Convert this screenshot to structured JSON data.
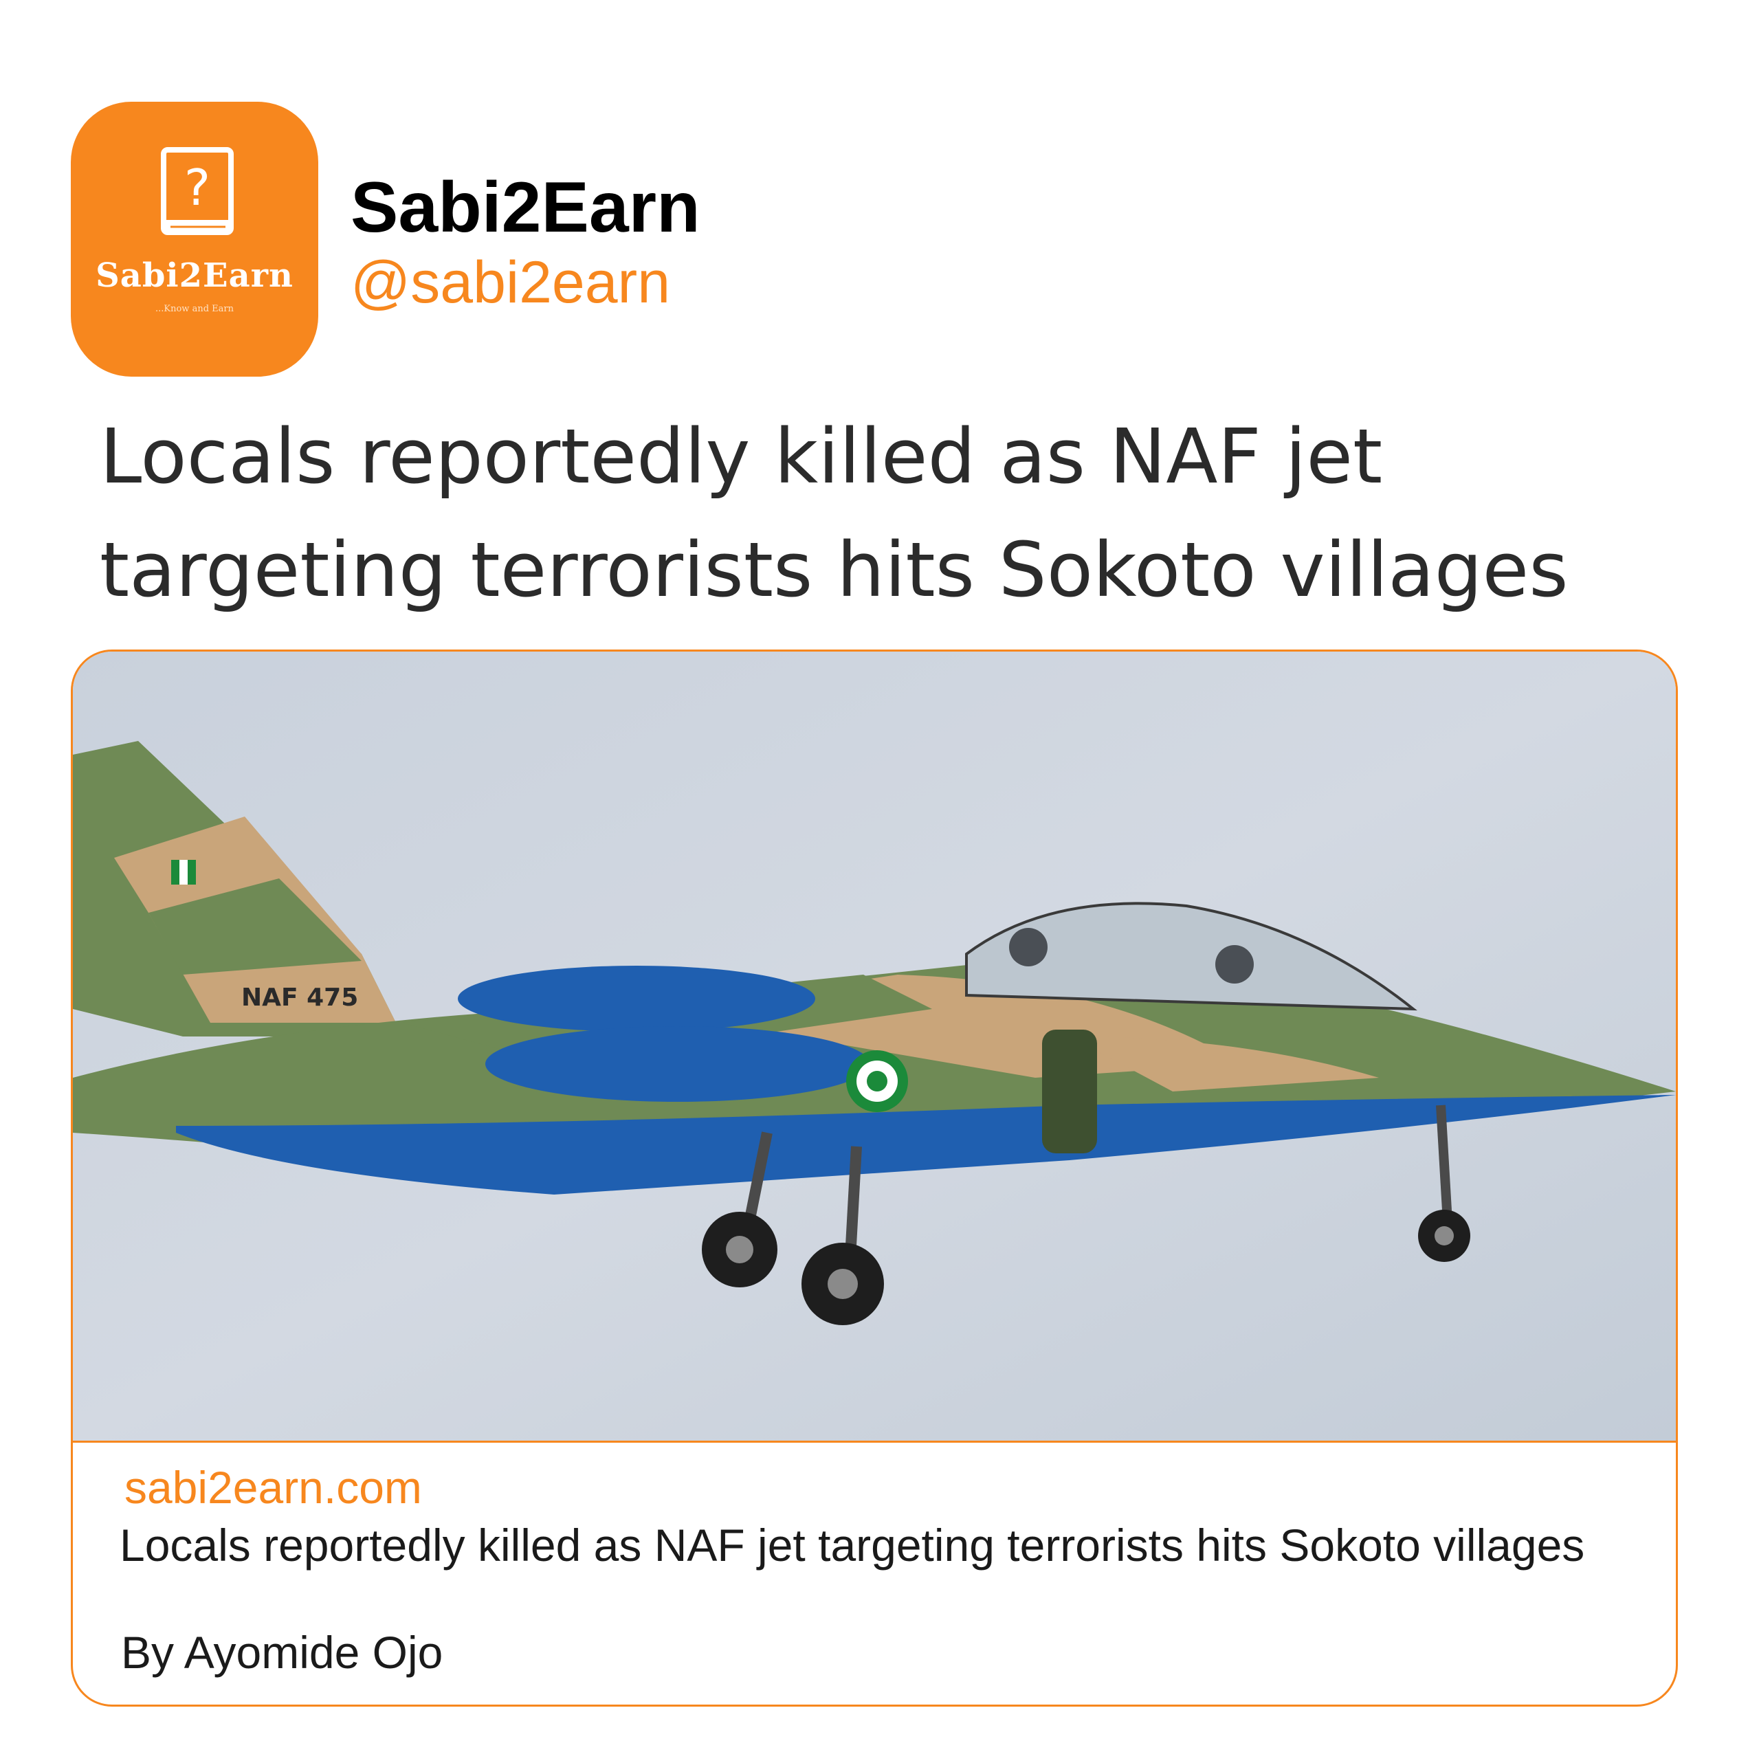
{
  "profile": {
    "display_name": "Sabi2Earn",
    "handle": "@sabi2earn",
    "avatar_brand": "Sabi2Earn",
    "avatar_tagline": "...Know and Earn",
    "avatar_icon": "book-question-icon"
  },
  "post": {
    "headline": "Locals reportedly killed as NAF jet targeting terrorists hits Sokoto villages"
  },
  "link_card": {
    "image_name": "naf-jet-photo",
    "aircraft_marking": "NAF 475",
    "domain": "sabi2earn.com",
    "title": "Locals reportedly killed as NAF jet targeting terrorists hits Sokoto villages",
    "author": "By Ayomide Ojo"
  },
  "colors": {
    "accent": "#f7871e",
    "headline_text": "#2b2b2b",
    "body_text": "#1a1a1a"
  }
}
